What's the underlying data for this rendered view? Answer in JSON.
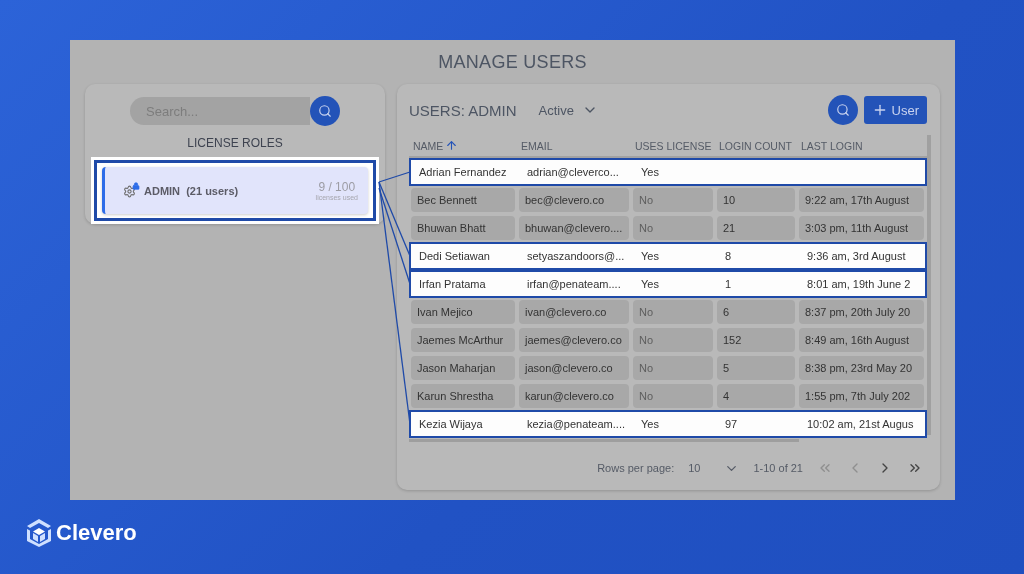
{
  "screen": {
    "title": "MANAGE USERS"
  },
  "roles_panel": {
    "search": {
      "placeholder": "Search..."
    },
    "heading": "LICENSE ROLES",
    "roles": [
      {
        "name": "ADMIN",
        "users": "(21 users)",
        "count": "9 / 100",
        "count_label": "licenses used",
        "selected": true,
        "highlighted": true
      }
    ]
  },
  "users_panel": {
    "title": "USERS: ADMIN",
    "filter": "Active",
    "add_button": "User",
    "columns": [
      {
        "label": "NAME",
        "sorted": true
      },
      {
        "label": "EMAIL",
        "sorted": false
      },
      {
        "label": "USES LICENSE",
        "sorted": false
      },
      {
        "label": "LOGIN COUNT",
        "sorted": false
      },
      {
        "label": "LAST LOGIN",
        "sorted": false
      }
    ],
    "rows": [
      {
        "name": "Adrian Fernandez",
        "email": "adrian@cleverco...",
        "uses_license": "Yes",
        "licensed": true,
        "highlighted": true
      },
      {
        "name": "Bec Bennett",
        "email": "bec@clevero.co",
        "uses_license": "No",
        "licensed": false,
        "login_count": "10",
        "last_login": "9:22 am, 17th August",
        "highlighted": false
      },
      {
        "name": "Bhuwan Bhatt",
        "email": "bhuwan@clevero....",
        "uses_license": "No",
        "licensed": false,
        "login_count": "21",
        "last_login": "3:03 pm, 11th August",
        "highlighted": false
      },
      {
        "name": "Dedi Setiawan",
        "email": "setyaszandoors@...",
        "uses_license": "Yes",
        "licensed": true,
        "login_count": "8",
        "last_login": "9:36 am, 3rd August",
        "highlighted": true
      },
      {
        "name": "Irfan Pratama",
        "email": "irfan@penateam....",
        "uses_license": "Yes",
        "licensed": true,
        "login_count": "1",
        "last_login": "8:01 am, 19th June 2",
        "highlighted": true
      },
      {
        "name": "Ivan Mejico",
        "email": "ivan@clevero.co",
        "uses_license": "No",
        "licensed": false,
        "login_count": "6",
        "last_login": "8:37 pm, 20th July 20",
        "highlighted": false
      },
      {
        "name": "Jaemes McArthur",
        "email": "jaemes@clevero.co",
        "uses_license": "No",
        "licensed": false,
        "login_count": "152",
        "last_login": "8:49 am, 16th August",
        "highlighted": false
      },
      {
        "name": "Jason Maharjan",
        "email": "jason@clevero.co",
        "uses_license": "No",
        "licensed": false,
        "login_count": "5",
        "last_login": "8:38 pm, 23rd May 20",
        "highlighted": false
      },
      {
        "name": "Karun Shrestha",
        "email": "karun@clevero.co",
        "uses_license": "No",
        "licensed": false,
        "login_count": "4",
        "last_login": "1:55 pm, 7th July 202",
        "highlighted": false
      },
      {
        "name": "Kezia Wijaya",
        "email": "kezia@penateam....",
        "uses_license": "Yes",
        "licensed": true,
        "login_count": "97",
        "last_login": "10:02 am, 21st Augus",
        "highlighted": true
      }
    ],
    "pagination": {
      "rows_per_page_label": "Rows per page:",
      "rows_per_page": "10",
      "range": "1-10 of 21",
      "nav": [
        {
          "kind": "first",
          "disabled": true
        },
        {
          "kind": "prev",
          "disabled": true
        },
        {
          "kind": "next",
          "disabled": false
        },
        {
          "kind": "last",
          "disabled": false
        }
      ]
    }
  },
  "brand": {
    "name": "Clevero"
  }
}
